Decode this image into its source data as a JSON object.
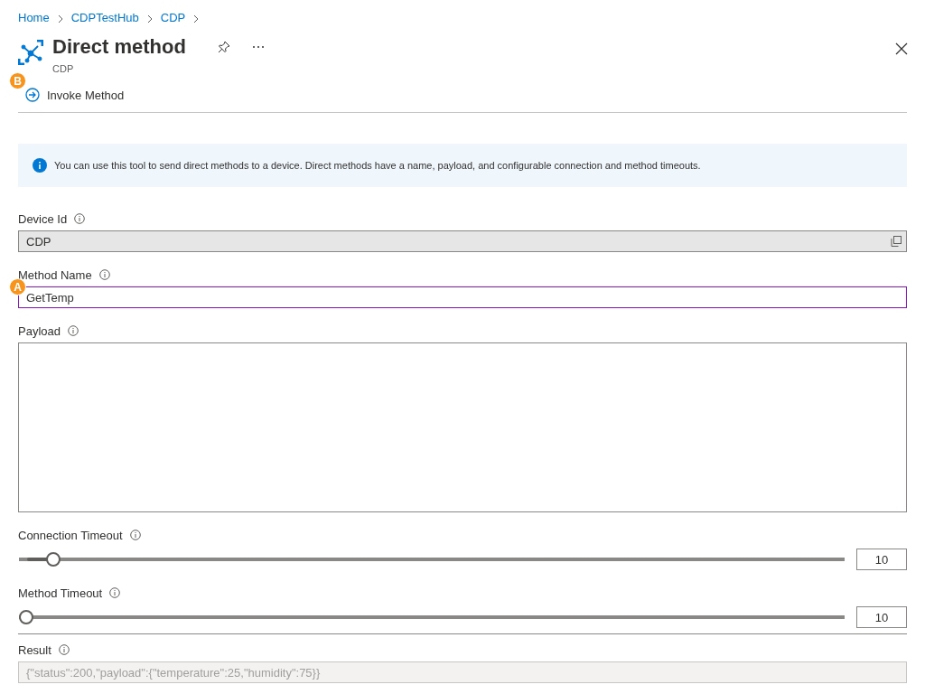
{
  "breadcrumb": [
    "Home",
    "CDPTestHub",
    "CDP"
  ],
  "blade": {
    "title": "Direct method",
    "subtitle": "CDP"
  },
  "toolbar": [
    {
      "label": "Invoke Method",
      "callout": "B"
    }
  ],
  "info_message": "You can use this tool to send direct methods to a device. Direct methods have a name, payload, and configurable connection and method timeouts.",
  "fields": [
    {
      "kind": "text",
      "label": "Device Id",
      "value": "CDP",
      "disabled": true,
      "copyable": true,
      "focused": false
    },
    {
      "kind": "text",
      "label": "Method Name",
      "value": "GetTemp",
      "disabled": false,
      "copyable": false,
      "focused": true,
      "callout": "A"
    },
    {
      "kind": "textarea",
      "label": "Payload",
      "disabled": false,
      "focused": false
    },
    {
      "kind": "slider",
      "label": "Connection Timeout",
      "level": 0.034,
      "value": "10"
    },
    {
      "kind": "slider",
      "label": "Method Timeout",
      "level": 0,
      "value": "10"
    }
  ],
  "result": {
    "label": "Result",
    "value": "{\"status\":200,\"payload\":{\"temperature\":25,\"humidity\":75}}",
    "disabled": true
  }
}
